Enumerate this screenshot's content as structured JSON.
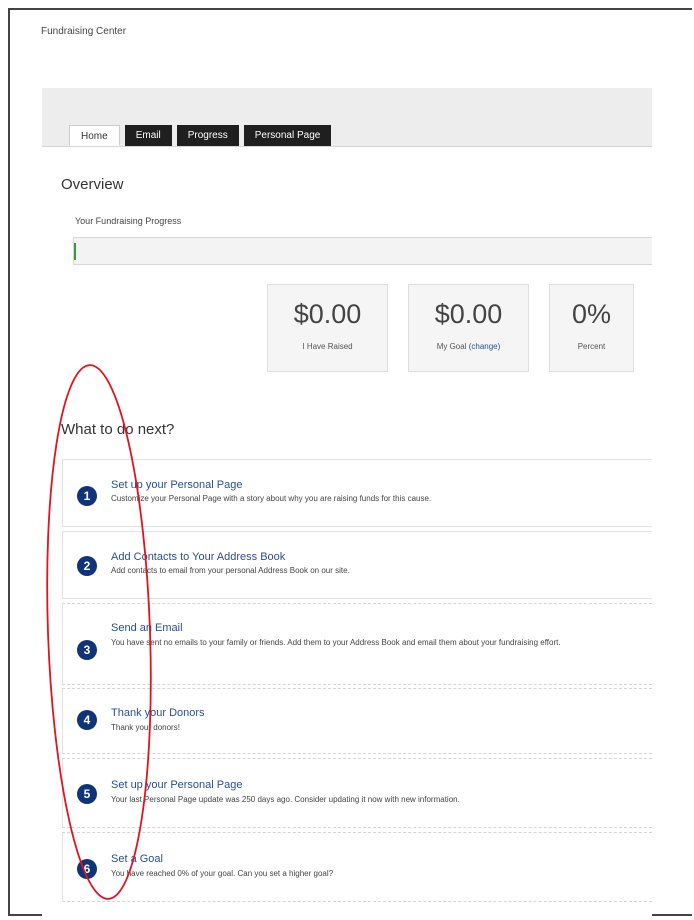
{
  "app_title": "Fundraising Center",
  "tabs": [
    {
      "label": "Home",
      "active": true
    },
    {
      "label": "Email",
      "active": false
    },
    {
      "label": "Progress",
      "active": false
    },
    {
      "label": "Personal Page",
      "active": false
    }
  ],
  "overview": {
    "title": "Overview",
    "progress_label": "Your Fundraising Progress",
    "progress_fraction": 0.0
  },
  "stats": {
    "raised": {
      "value": "$0.00",
      "label": "I Have Raised"
    },
    "goal": {
      "value": "$0.00",
      "label": "My Goal",
      "link": "(change)"
    },
    "percent": {
      "value": "0%",
      "label": "Percent"
    }
  },
  "next": {
    "title": "What to do next?",
    "steps": [
      {
        "num": "1",
        "title": "Set up your Personal Page",
        "desc": "Customize your Personal Page with a story about why you are raising funds for this cause."
      },
      {
        "num": "2",
        "title": "Add Contacts to Your Address Book",
        "desc": "Add contacts to email from your personal Address Book on our site."
      },
      {
        "num": "3",
        "title": "Send an Email",
        "desc": "You have sent no emails to your family or friends. Add them to your Address Book and email them about your fundraising effort."
      },
      {
        "num": "4",
        "title": "Thank your Donors",
        "desc": "Thank your donors!"
      },
      {
        "num": "5",
        "title": "Set up your Personal Page",
        "desc": "Your last Personal Page update was 250 days ago. Consider updating it now with new information."
      },
      {
        "num": "6",
        "title": "Set a Goal",
        "desc": "You have reached 0% of your goal. Can you set a higher goal?"
      }
    ]
  },
  "colors": {
    "accent_blue": "#10347a",
    "link_blue": "#2a4f91",
    "tab_dark": "#1f1f1f",
    "annotation_red": "#e0141e",
    "progress_green": "#3a9a3a"
  }
}
